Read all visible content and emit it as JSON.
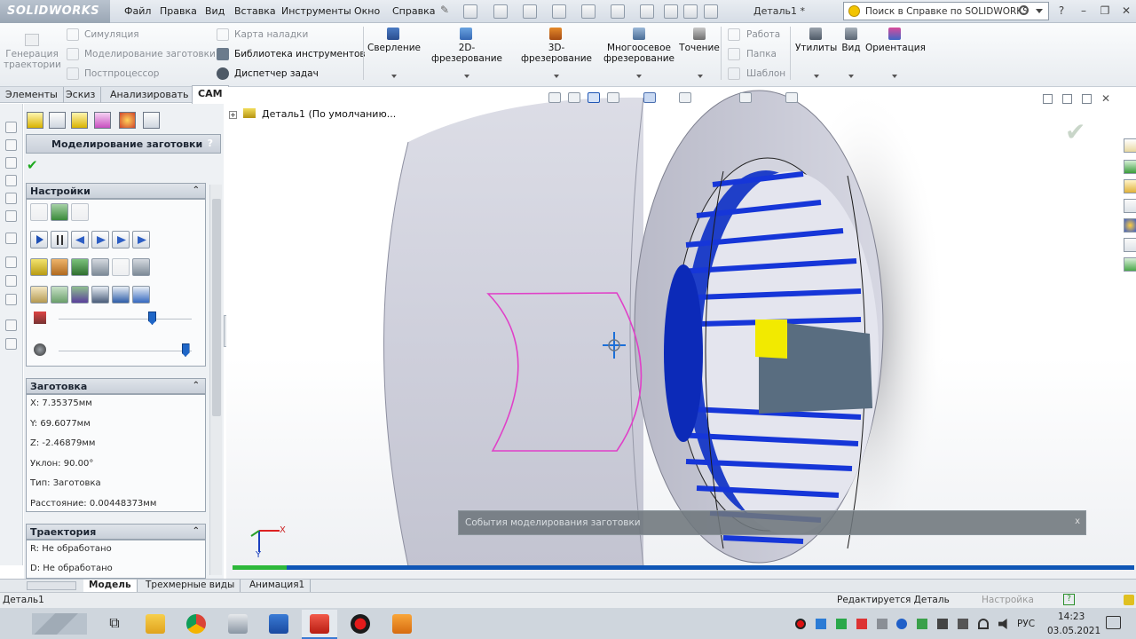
{
  "app": {
    "brand": "SOLIDWORKS",
    "document_title": "Деталь1 *"
  },
  "menu": [
    "Файл",
    "Правка",
    "Вид",
    "Вставка",
    "Инструменты",
    "Окно",
    "Справка"
  ],
  "search": {
    "placeholder": "Поиск в Справке по SOLIDWORKS"
  },
  "command_manager": {
    "generate": "Генерация траектории",
    "small_col1": [
      "Симуляция",
      "Моделирование заготовки",
      "Постпроцессор"
    ],
    "small_col2": [
      "Карта наладки",
      "Библиотека инструментов",
      "Диспетчер задач"
    ],
    "big_ops": [
      "Сверление",
      "2D-фрезерование",
      "3D-фрезерование",
      "Многоосевое фрезерование",
      "Точение"
    ],
    "small_col3": [
      "Работа",
      "Папка",
      "Шаблон"
    ],
    "right_ops": [
      "Утилиты",
      "Вид",
      "Ориентация"
    ]
  },
  "tabs": [
    {
      "label": "Элементы",
      "active": false
    },
    {
      "label": "Эскиз",
      "active": false
    },
    {
      "label": "Анализировать",
      "active": false
    },
    {
      "label": "CAM",
      "active": true
    }
  ],
  "feature_tree": {
    "root": "Деталь1  (По умолчанию..."
  },
  "property_manager": {
    "title": "Моделирование заготовки",
    "help": "?",
    "settings_header": "Настройки",
    "stock_header": "Заготовка",
    "stock_rows": [
      "X: 7.35375мм",
      "Y: 69.6077мм",
      "Z: -2.46879мм",
      "Уклон: 90.00°",
      "Тип: Заготовка",
      "Расстояние: 0.00448373мм"
    ],
    "path_header": "Траектория",
    "path_rows": [
      "R: Не обработано",
      "D: Не обработано"
    ],
    "speed_slider_value": 0.7,
    "quality_slider_value": 0.95
  },
  "event_bar": {
    "text": "События моделирования заготовки",
    "close": "x"
  },
  "simulation_progress": 0.06,
  "triad": {
    "x": "X",
    "y": "Y"
  },
  "bottom_tabs": [
    {
      "label": "Модель",
      "active": true
    },
    {
      "label": "Трехмерные виды",
      "active": false
    },
    {
      "label": "Анимация1",
      "active": false
    }
  ],
  "status": {
    "left": "Деталь1",
    "middle": "Редактируется Деталь",
    "right": "Настройка"
  },
  "taskbar": {
    "lang": "РУС",
    "time": "14:23",
    "date": "03.05.2021"
  },
  "colors": {
    "accent": "#0d3fd6",
    "stock": "#d2d4e0",
    "tool": "#f5e800",
    "path": "#e040c8"
  }
}
